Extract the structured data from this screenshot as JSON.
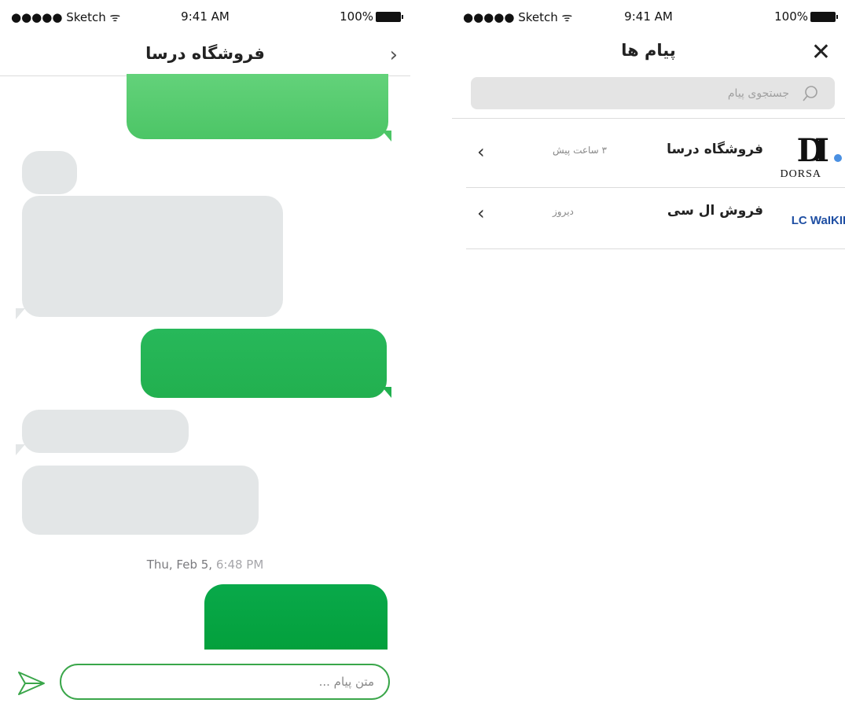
{
  "status_bar": {
    "carrier": "●●●●● Sketch",
    "time": "9:41 AM",
    "battery": "100%"
  },
  "chat_screen": {
    "title": "فروشگاه درسا",
    "back_icon": "chevron-right-icon",
    "date_label": "Thu, Feb 5,",
    "time_label": "6:48 PM",
    "input_placeholder": "متن پیام ...",
    "send_icon": "paper-plane-icon",
    "colors": {
      "outgoing_1": "#5ccd74",
      "outgoing_2": "#25b455",
      "outgoing_3": "#06a443",
      "incoming": "#e3e6e7",
      "input_border": "#3aa64a"
    }
  },
  "list_screen": {
    "title": "پیام ها",
    "close_icon": "close-icon",
    "search_placeholder": "جستجوی پیام",
    "search_icon": "search-icon",
    "conversations": [
      {
        "name": "فروشگاه درسا",
        "time": "۳ ساعت پیش",
        "unread": true,
        "logo_text": "DORSA",
        "logo_mark": "DI"
      },
      {
        "name": "فروش ال سی",
        "time": "دیروز",
        "unread": false,
        "logo_text": "LC WaIKIKI"
      }
    ],
    "colors": {
      "unread_dot": "#4a90e2",
      "lcw_brand": "#1f4fa3"
    }
  }
}
